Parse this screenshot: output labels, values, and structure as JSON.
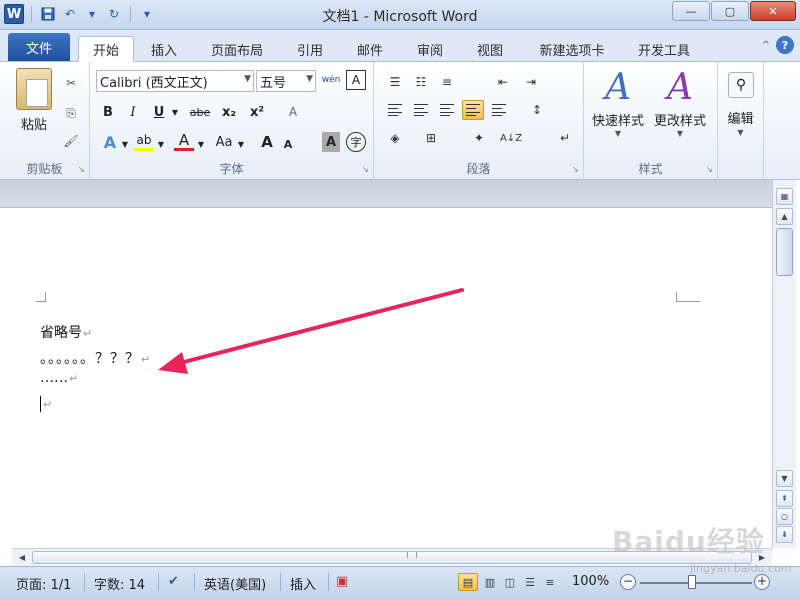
{
  "window": {
    "title": "文档1 - Microsoft Word",
    "app_logo": "W",
    "controls": {
      "minimize": "—",
      "maximize": "▢",
      "close": "✕"
    }
  },
  "qat": {
    "save_icon": "floppy-icon",
    "undo": "↶",
    "redo": "↻",
    "customize": "▾"
  },
  "tabs": {
    "file": "文件",
    "items": [
      "开始",
      "插入",
      "页面布局",
      "引用",
      "邮件",
      "审阅",
      "视图",
      "新建选项卡",
      "开发工具"
    ],
    "active": "开始",
    "help": "?",
    "collapse": "^"
  },
  "ribbon": {
    "clipboard": {
      "paste": "粘贴",
      "label": "剪贴板",
      "cut": "✂",
      "copy": "⎘",
      "painter": "🖌"
    },
    "font": {
      "font_name": "Calibri (西文正文)",
      "font_size": "五号",
      "phonetic": "wén",
      "border_char": "A",
      "bold": "B",
      "italic": "I",
      "underline": "U",
      "strike": "abe",
      "subscript": "x₂",
      "superscript": "x²",
      "clear": "A",
      "text_effect": "A",
      "highlight": "ab",
      "font_color": "A",
      "case": "Aa",
      "grow": "A",
      "shrink": "A",
      "shade": "A",
      "enclose": "字",
      "label": "字体",
      "highlight_color": "#ffff00",
      "font_color_value": "#e02020"
    },
    "paragraph": {
      "label": "段落",
      "sort": "A↓Z"
    },
    "styles": {
      "quick": "快速样式",
      "change": "更改样式",
      "label": "样式"
    },
    "editing": {
      "label": "编辑"
    }
  },
  "document": {
    "lines": [
      "省略号",
      "。。。。。。？？？",
      "……"
    ],
    "pilcrow": "↵"
  },
  "status": {
    "page": "页面: 1/1",
    "words": "字数: 14",
    "language": "英语(美国)",
    "insert": "插入",
    "zoom": "100%",
    "zoom_minus": "−",
    "zoom_plus": "+"
  },
  "watermark": {
    "main": "Baidu经验",
    "sub": "jingyan.baidu.com"
  },
  "annotation": {
    "arrow_color": "#e8245c"
  }
}
